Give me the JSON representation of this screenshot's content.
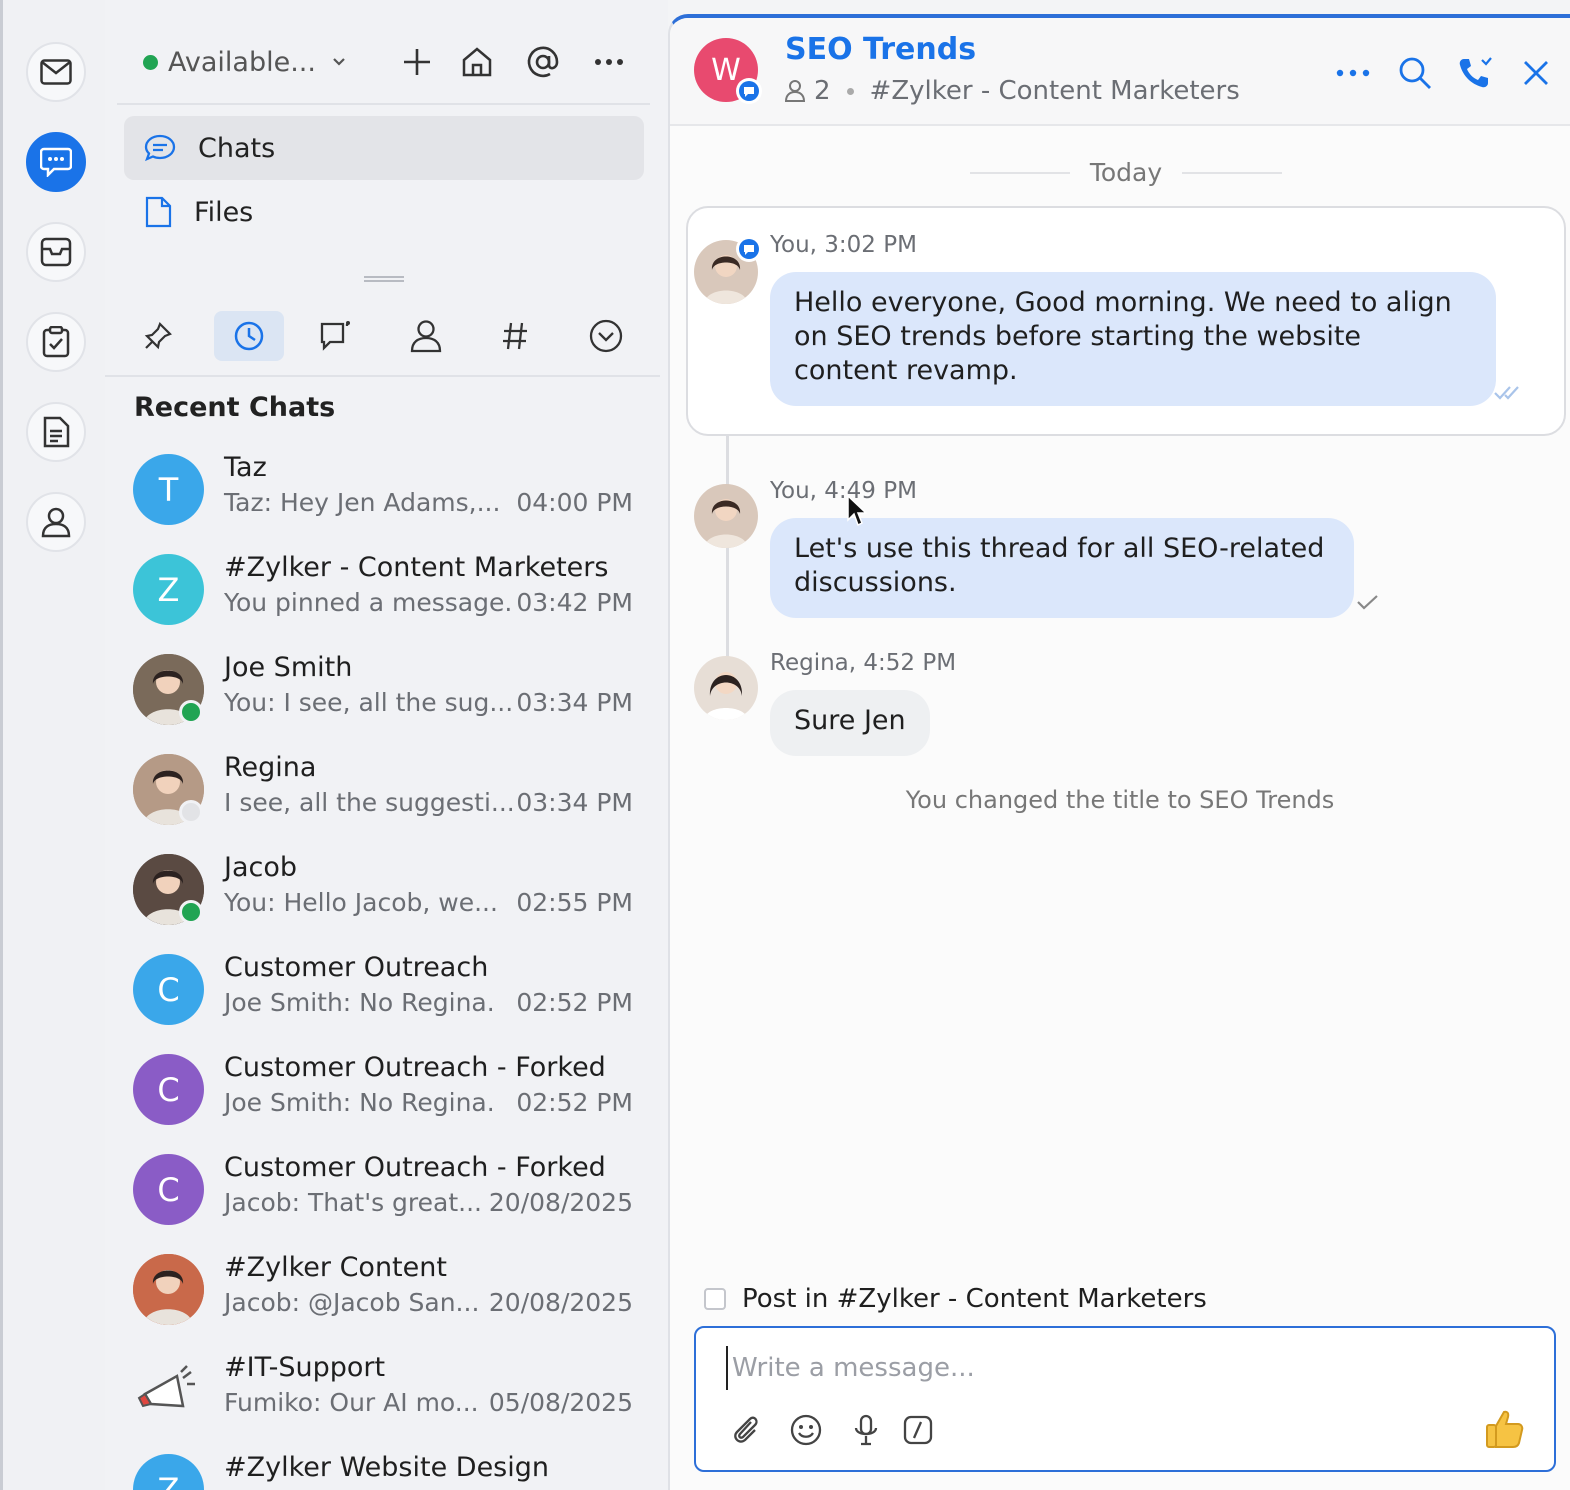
{
  "rail": {
    "items": [
      {
        "name": "mail-icon"
      },
      {
        "name": "chat-icon",
        "active": true
      },
      {
        "name": "inbox-icon"
      },
      {
        "name": "tasks-icon"
      },
      {
        "name": "notes-icon"
      },
      {
        "name": "contacts-icon"
      }
    ]
  },
  "sidebar": {
    "status_label": "Available...",
    "status_color": "#21a453",
    "nav": [
      {
        "label": "Chats",
        "icon": "chat-bubble-icon",
        "active": true
      },
      {
        "label": "Files",
        "icon": "file-icon",
        "active": false
      }
    ],
    "tabs": [
      "pin-icon",
      "recent-icon",
      "threads-icon",
      "contacts-icon",
      "channels-icon",
      "more-chevron-icon"
    ],
    "recent_title": "Recent Chats",
    "chats": [
      {
        "name": "Taz",
        "preview": "Taz: Hey Jen Adams,...",
        "time": "04:00 PM",
        "initial": "T",
        "color": "#3aa7ea",
        "presence": ""
      },
      {
        "name": "#Zylker - Content Marketers",
        "preview": "You pinned a message.",
        "time": "03:42 PM",
        "initial": "Z",
        "color": "#3cc4d8",
        "presence": ""
      },
      {
        "name": "Joe Smith",
        "preview": "You: I see, all the sug...",
        "time": "03:34 PM",
        "initial": "",
        "color": "#7a6a5a",
        "presence": "online"
      },
      {
        "name": "Regina",
        "preview": "I see, all the suggesti...",
        "time": "03:34 PM",
        "initial": "",
        "color": "#b59a86",
        "presence": "away"
      },
      {
        "name": "Jacob",
        "preview": "You: Hello Jacob, we...",
        "time": "02:55 PM",
        "initial": "",
        "color": "#5a4a42",
        "presence": "online"
      },
      {
        "name": "Customer Outreach",
        "preview": "Joe Smith: No Regina.",
        "time": "02:52 PM",
        "initial": "C",
        "color": "#3aa7ea",
        "presence": ""
      },
      {
        "name": "Customer Outreach - Forked",
        "preview": "Joe Smith: No Regina.",
        "time": "02:52 PM",
        "initial": "C",
        "color": "#8a5cc6",
        "presence": ""
      },
      {
        "name": "Customer Outreach - Forked",
        "preview": "Jacob: That's great...",
        "time": "20/08/2025",
        "initial": "C",
        "color": "#8a5cc6",
        "presence": ""
      },
      {
        "name": "#Zylker Content",
        "preview": "Jacob: @Jacob San...",
        "time": "20/08/2025",
        "initial": "",
        "color": "#c9694a",
        "presence": ""
      },
      {
        "name": "#IT-Support",
        "preview": "Fumiko: Our AI mo...",
        "time": "05/08/2025",
        "initial": "",
        "color": "#f1f2f5",
        "presence": ""
      },
      {
        "name": "#Zylker Website Design",
        "preview": "",
        "time": "",
        "initial": "Z",
        "color": "#3aa7ea",
        "presence": ""
      }
    ]
  },
  "chat": {
    "avatar_initial": "W",
    "avatar_color": "#e84a6f",
    "title": "SEO Trends",
    "member_count": "2",
    "channel": "#Zylker - Content Marketers",
    "date_divider": "Today",
    "messages": [
      {
        "meta": "You, 3:02 PM",
        "text": "Hello everyone, Good morning. We need to align on SEO trends before starting the website content revamp.",
        "direction": "out",
        "status": "read"
      },
      {
        "meta": "You, 4:49 PM",
        "text": "Let's use this thread for all SEO-related discussions.",
        "direction": "out",
        "status": "sent"
      },
      {
        "meta": "Regina, 4:52 PM",
        "text": "Sure Jen",
        "direction": "in",
        "status": ""
      }
    ],
    "system_message": "You changed the title to SEO Trends",
    "post_in_label": "Post in #Zylker - Content Marketers",
    "input_placeholder": "Write a message...",
    "accent": "#1a73e8"
  }
}
